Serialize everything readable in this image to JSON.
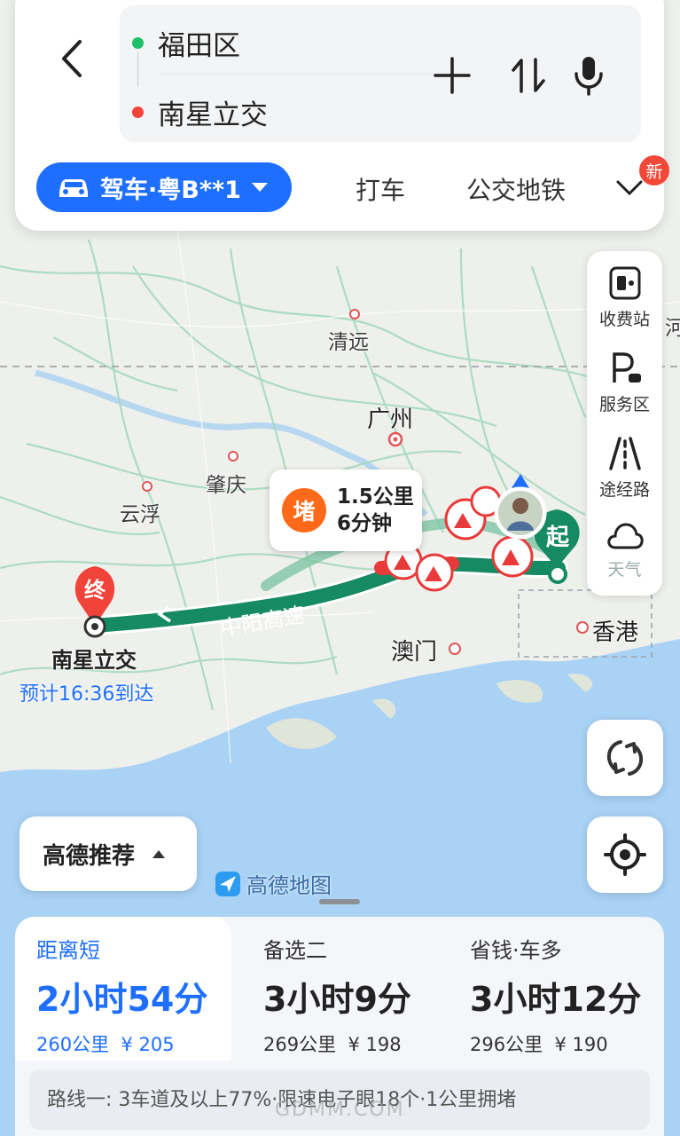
{
  "route": {
    "origin": "福田区",
    "destination": "南星立交",
    "origin_color": "#20c06a",
    "destination_color": "#f0433a"
  },
  "modes": {
    "active": "驾车·粤B**1",
    "taxi": "打车",
    "transit": "公交地铁",
    "new_badge": "新"
  },
  "map": {
    "cities": {
      "qingyuan": "清远",
      "guangzhou": "广州",
      "zhaoqing": "肇庆",
      "yunfu": "云浮",
      "macau": "澳门",
      "hongkong": "香港",
      "edge_right": "河"
    },
    "highway_name": "中阳高速",
    "start_marker": "起",
    "end_marker": "终",
    "destination_label": "南星立交",
    "eta": "预计16:36到达",
    "route_color": "#168a63"
  },
  "jam": {
    "icon": "堵",
    "distance": "1.5公里",
    "duration": "6分钟"
  },
  "toolbar": {
    "toll": "收费站",
    "service": "服务区",
    "waypoint": "途经路",
    "weather": "天气"
  },
  "recommend_label": "高德推荐",
  "logo_text": "高德地图",
  "routes": [
    {
      "tag": "距离短",
      "time": "2小时54分",
      "distance": "260公里",
      "cost": "¥ 205"
    },
    {
      "tag": "备选二",
      "time": "3小时9分",
      "distance": "269公里",
      "cost": "¥ 198"
    },
    {
      "tag": "省钱·车多",
      "time": "3小时12分",
      "distance": "296公里",
      "cost": "¥ 190"
    }
  ],
  "route_summary": "路线一: 3车道及以上77%·限速电子眼18个·1公里拥堵",
  "watermark": "GDMM.COM"
}
